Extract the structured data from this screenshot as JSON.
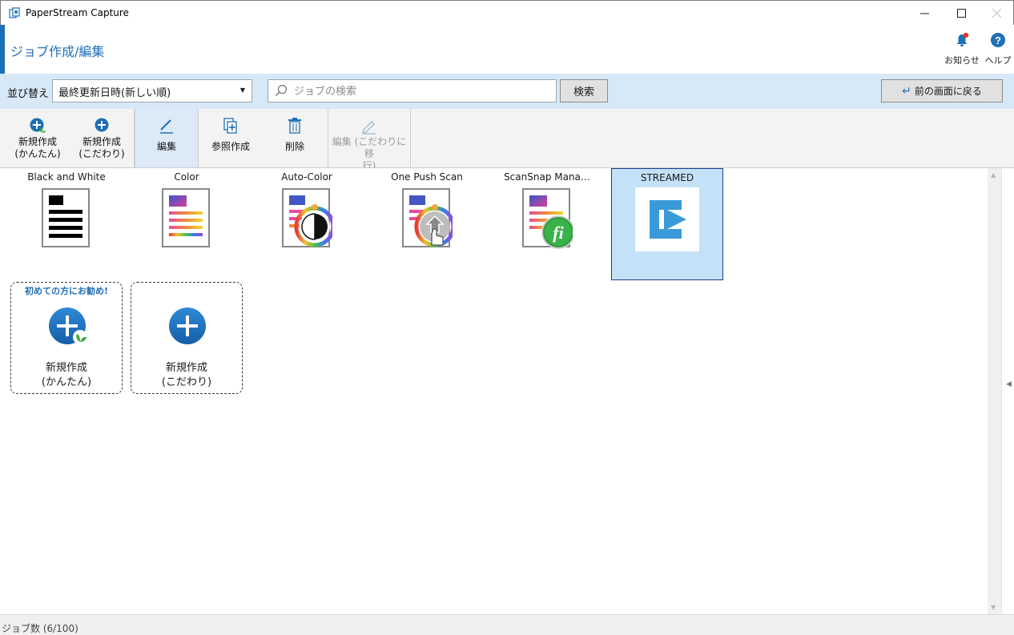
{
  "window": {
    "title": "PaperStream Capture",
    "minimize": "—",
    "maximize": "☐",
    "close": "✕"
  },
  "header": {
    "title": "ジョブ作成/編集",
    "notifications_label": "お知らせ",
    "help_label": "ヘルプ"
  },
  "searchbar": {
    "sort_label": "並び替え",
    "sort_value": "最終更新日時(新しい順)",
    "search_placeholder": "ジョブの検索",
    "search_button": "検索",
    "back_button": "前の画面に戻る"
  },
  "toolbar": {
    "new_easy": "新規作成\n(かんたん)",
    "new_custom": "新規作成\n(こだわり)",
    "edit": "編集",
    "copy_create": "参照作成",
    "delete": "削除",
    "edit_migrate": "編集 (こだわりに移\n行)"
  },
  "jobs": [
    {
      "name": "Black and White",
      "icon": "bw-document-icon"
    },
    {
      "name": "Color",
      "icon": "color-document-icon"
    },
    {
      "name": "Auto-Color",
      "icon": "auto-color-document-icon"
    },
    {
      "name": "One Push Scan",
      "icon": "one-push-scan-icon"
    },
    {
      "name": "ScanSnap Mana…",
      "icon": "scansnap-manager-icon"
    },
    {
      "name": "STREAMED",
      "icon": "streamed-icon",
      "selected": true
    }
  ],
  "new_cards": {
    "easy_tag": "初めての方にお勧め!",
    "easy_label": "新規作成\n(かんたん)",
    "custom_label": "新規作成\n(こだわり)"
  },
  "status": {
    "job_count": "ジョブ数 (6/100)"
  },
  "colors": {
    "accent": "#1f6fb4",
    "selection": "#c3e1f7",
    "searchbar": "#d7e8f7",
    "notification_dot": "#e8332a"
  }
}
